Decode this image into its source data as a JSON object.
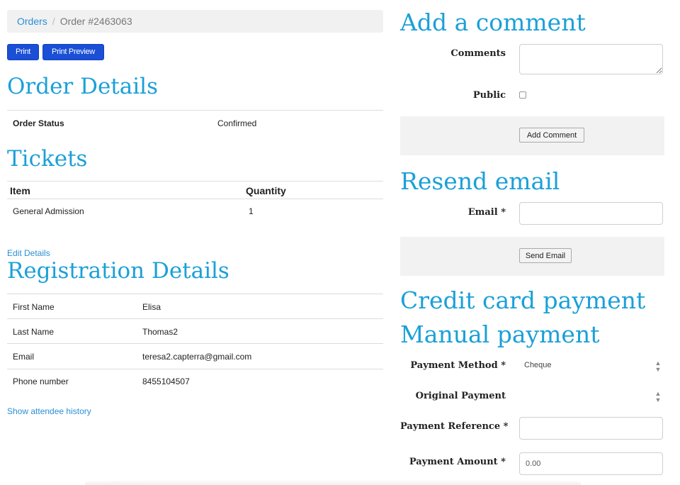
{
  "breadcrumb": {
    "orders": "Orders",
    "separator": "/",
    "current": "Order #2463063"
  },
  "toolbar": {
    "print": "Print",
    "print_preview": "Print Preview"
  },
  "order_details": {
    "title": "Order Details",
    "status_label": "Order Status",
    "status_value": "Confirmed"
  },
  "tickets": {
    "title": "Tickets",
    "headers": {
      "item": "Item",
      "quantity": "Quantity"
    },
    "rows": [
      {
        "item": "General Admission",
        "quantity": "1"
      }
    ]
  },
  "registration": {
    "edit_link": "Edit Details",
    "title": "Registration Details",
    "rows": [
      {
        "label": "First Name",
        "value": "Elisa"
      },
      {
        "label": "Last Name",
        "value": "Thomas2"
      },
      {
        "label": "Email",
        "value": "teresa2.capterra@gmail.com"
      },
      {
        "label": "Phone number",
        "value": "8455104507"
      }
    ],
    "history_link": "Show attendee history"
  },
  "comment": {
    "title": "Add a comment",
    "comments_label": "Comments",
    "comments_value": "",
    "public_label": "Public",
    "public_checked": false,
    "button": "Add Comment"
  },
  "resend": {
    "title": "Resend email",
    "email_label": "Email *",
    "email_value": "",
    "button": "Send Email"
  },
  "credit_card": {
    "title": "Credit card payment"
  },
  "manual_payment": {
    "title": "Manual payment",
    "method_label": "Payment Method *",
    "method_value": "Cheque",
    "original_label": "Original Payment",
    "original_value": "",
    "reference_label": "Payment Reference *",
    "reference_value": "",
    "amount_label": "Payment Amount *",
    "amount_value": "0.00"
  },
  "colors": {
    "heading": "#1ba0d8",
    "link": "#2a8fd4",
    "primary_button": "#1a4fd6"
  }
}
